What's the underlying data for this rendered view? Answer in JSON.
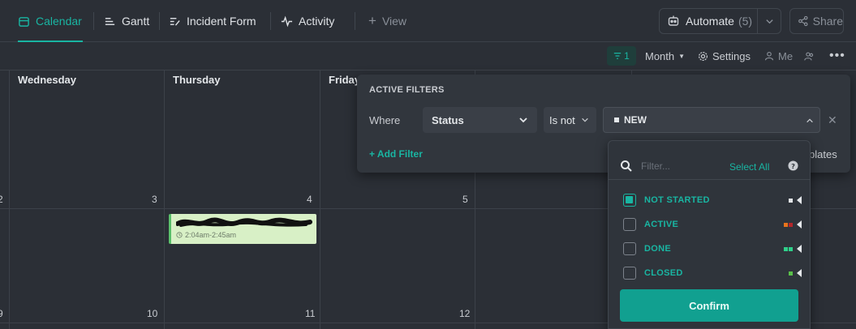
{
  "tabs": [
    {
      "label": "Calendar",
      "icon": "calendar-icon",
      "active": true
    },
    {
      "label": "Gantt",
      "icon": "gantt-icon"
    },
    {
      "label": "Incident Form",
      "icon": "form-icon"
    },
    {
      "label": "Activity",
      "icon": "activity-icon"
    }
  ],
  "add_view_label": "View",
  "automate": {
    "label": "Automate",
    "count": "(5)"
  },
  "share_label": "Share",
  "toolbar": {
    "filter_count": "1",
    "month_label": "Month",
    "settings_label": "Settings",
    "me_label": "Me"
  },
  "calendar": {
    "days": [
      "Wednesday",
      "Thursday",
      "Friday"
    ],
    "week1_numbers": [
      "2",
      "3",
      "4",
      "5"
    ],
    "week2_numbers": [
      "9",
      "10",
      "11",
      "12"
    ],
    "event": {
      "time": "2:04am-2:45am",
      "color": "#d8f0c6",
      "border_color": "#5ac06a"
    }
  },
  "filters": {
    "title": "ACTIVE FILTERS",
    "where_label": "Where",
    "field": "Status",
    "operator": "Is not",
    "value": "NEW",
    "add_filter_label": "+ Add Filter",
    "templates_partial": "plates"
  },
  "status_dropdown": {
    "search_placeholder": "Filter...",
    "select_all_label": "Select All",
    "options": [
      {
        "label": "NOT STARTED",
        "checked": true,
        "swatches": [
          "#e4e7ea"
        ]
      },
      {
        "label": "ACTIVE",
        "checked": false,
        "swatches": [
          "#e8741c",
          "#b5262a"
        ]
      },
      {
        "label": "DONE",
        "checked": false,
        "swatches": [
          "#2fd08a",
          "#2fd08a"
        ]
      },
      {
        "label": "CLOSED",
        "checked": false,
        "swatches": [
          "#5ac04a"
        ]
      }
    ],
    "confirm_label": "Confirm"
  },
  "colors": {
    "accent": "#19b5a2",
    "background": "#2b2f36"
  }
}
